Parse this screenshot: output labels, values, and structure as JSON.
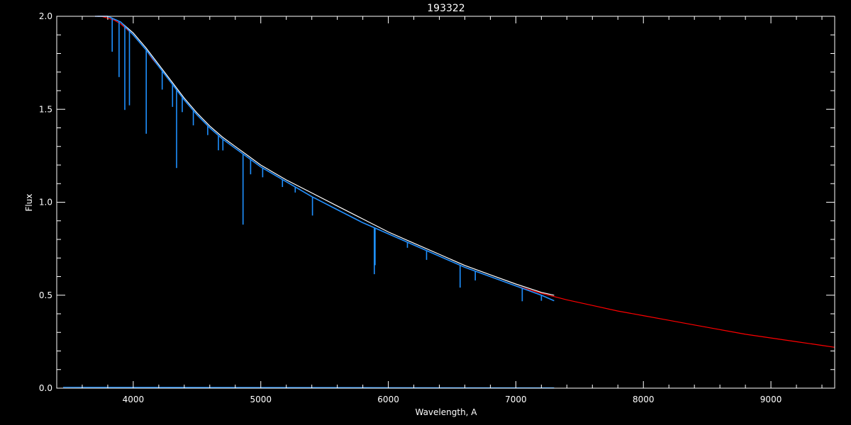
{
  "chart_data": {
    "type": "line",
    "title": "193322",
    "xlabel": "Wavelength, A",
    "ylabel": "Flux",
    "xlim": [
      3400,
      9500
    ],
    "ylim": [
      0.0,
      2.0
    ],
    "x_ticks": [
      4000,
      5000,
      6000,
      7000,
      8000,
      9000
    ],
    "x_tick_labels": [
      "4000",
      "5000",
      "6000",
      "7000",
      "8000",
      "9000"
    ],
    "y_ticks": [
      0.0,
      0.5,
      1.0,
      1.5,
      2.0
    ],
    "y_tick_labels": [
      "0.0",
      "0.5",
      "1.0",
      "1.5",
      "2.0"
    ],
    "grid": false,
    "background": "#000000",
    "axis_color": "#ffffff",
    "absorption_lines": [
      {
        "x": 3835,
        "depth": 0.18
      },
      {
        "x": 3889,
        "depth": 0.3
      },
      {
        "x": 3934,
        "depth": 0.45
      },
      {
        "x": 3970,
        "depth": 0.4
      },
      {
        "x": 4102,
        "depth": 0.45
      },
      {
        "x": 4227,
        "depth": 0.1
      },
      {
        "x": 4308,
        "depth": 0.12
      },
      {
        "x": 4340,
        "depth": 0.42
      },
      {
        "x": 4384,
        "depth": 0.08
      },
      {
        "x": 4471,
        "depth": 0.08
      },
      {
        "x": 4584,
        "depth": 0.05
      },
      {
        "x": 4668,
        "depth": 0.08
      },
      {
        "x": 4703,
        "depth": 0.06
      },
      {
        "x": 4861,
        "depth": 0.38
      },
      {
        "x": 4920,
        "depth": 0.08
      },
      {
        "x": 5015,
        "depth": 0.05
      },
      {
        "x": 5170,
        "depth": 0.04
      },
      {
        "x": 5270,
        "depth": 0.03
      },
      {
        "x": 5405,
        "depth": 0.1
      },
      {
        "x": 5890,
        "depth": 0.25
      },
      {
        "x": 5896,
        "depth": 0.2
      },
      {
        "x": 6150,
        "depth": 0.03
      },
      {
        "x": 6300,
        "depth": 0.05
      },
      {
        "x": 6563,
        "depth": 0.12
      },
      {
        "x": 6682,
        "depth": 0.05
      },
      {
        "x": 7050,
        "depth": 0.07
      },
      {
        "x": 7200,
        "depth": 0.03
      }
    ],
    "series": [
      {
        "color": "#ff0000",
        "x": [
          3700,
          3750,
          3800,
          3850,
          3900,
          3950,
          4000,
          4050,
          4100,
          4150,
          4200,
          4300,
          4400,
          4500,
          4600,
          4700,
          4800,
          4900,
          5000,
          5200,
          5400,
          5600,
          5800,
          6000,
          6200,
          6400,
          6600,
          6800,
          7000,
          7200,
          7400,
          7600,
          7800,
          8000,
          8200,
          8400,
          8600,
          8800,
          9000,
          9200,
          9400,
          9500
        ],
        "y": [
          2.0,
          2.0,
          1.99,
          1.98,
          1.96,
          1.93,
          1.9,
          1.86,
          1.82,
          1.77,
          1.73,
          1.64,
          1.55,
          1.47,
          1.4,
          1.34,
          1.29,
          1.24,
          1.19,
          1.11,
          1.03,
          0.96,
          0.89,
          0.83,
          0.77,
          0.71,
          0.65,
          0.6,
          0.55,
          0.51,
          0.475,
          0.445,
          0.415,
          0.39,
          0.365,
          0.34,
          0.315,
          0.29,
          0.27,
          0.25,
          0.23,
          0.22
        ]
      },
      {
        "color": "#ffffff",
        "x": [
          3720,
          3800,
          3900,
          4000,
          4100,
          4200,
          4300,
          4400,
          4500,
          4600,
          4700,
          4800,
          4900,
          5000,
          5200,
          5400,
          5600,
          5800,
          6000,
          6200,
          6400,
          6600,
          6800,
          7000,
          7200,
          7300
        ],
        "y": [
          2.0,
          2.0,
          1.97,
          1.91,
          1.83,
          1.74,
          1.65,
          1.56,
          1.48,
          1.41,
          1.35,
          1.3,
          1.25,
          1.2,
          1.12,
          1.05,
          0.98,
          0.91,
          0.84,
          0.78,
          0.72,
          0.66,
          0.61,
          0.56,
          0.515,
          0.5
        ]
      },
      {
        "color": "#1e90ff",
        "x": [
          3700,
          3800,
          3900,
          4000,
          4100,
          4200,
          4300,
          4400,
          4500,
          4600,
          4700,
          4800,
          4900,
          5000,
          5200,
          5400,
          5600,
          5800,
          6000,
          6200,
          6400,
          6600,
          6800,
          7000,
          7200,
          7300
        ],
        "y": [
          2.0,
          2.0,
          1.97,
          1.9,
          1.82,
          1.73,
          1.64,
          1.55,
          1.47,
          1.4,
          1.34,
          1.29,
          1.24,
          1.19,
          1.11,
          1.03,
          0.96,
          0.89,
          0.83,
          0.77,
          0.71,
          0.65,
          0.6,
          0.55,
          0.5,
          0.47
        ]
      },
      {
        "color": "#1e90ff",
        "x": [
          3450,
          5000,
          6000,
          7300
        ],
        "y": [
          0.005,
          0.004,
          0.003,
          0.002
        ]
      }
    ]
  }
}
